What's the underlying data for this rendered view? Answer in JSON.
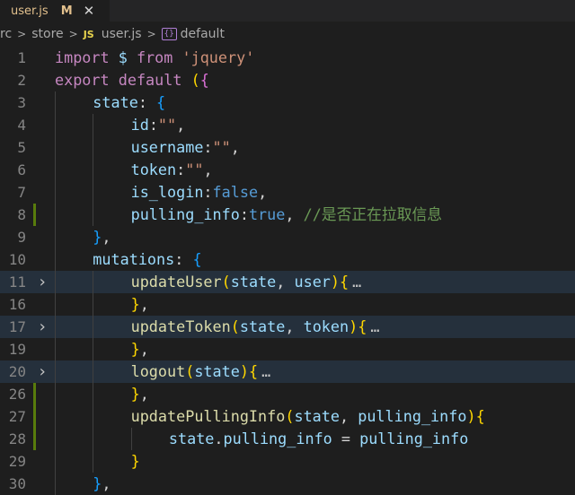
{
  "tab": {
    "label": "user.js",
    "modified": "M",
    "close": "✕"
  },
  "breadcrumb": {
    "segments": [
      "rc",
      "store",
      "user.js",
      "default"
    ],
    "file_badge": "JS"
  },
  "colors": {
    "keyword": "#c586c0",
    "storage": "#569cd6",
    "variable": "#9cdcfe",
    "function": "#dcdcaa",
    "string": "#ce9178",
    "comment": "#6a9955",
    "bracket1": "#ffd700",
    "bracket2": "#da70d6",
    "bracket3": "#179fff",
    "punct": "#d4d4d4",
    "fold": "#c5c5c5",
    "ellipsis": "#c5c5c5"
  },
  "lines": [
    {
      "num": "1",
      "indent": 0,
      "tokens": [
        {
          "t": "import",
          "c": "keyword"
        },
        {
          "t": " "
        },
        {
          "t": "$",
          "c": "variable"
        },
        {
          "t": " "
        },
        {
          "t": "from",
          "c": "keyword"
        },
        {
          "t": " "
        },
        {
          "t": "'jquery'",
          "c": "string"
        }
      ]
    },
    {
      "num": "2",
      "indent": 0,
      "tokens": [
        {
          "t": "export",
          "c": "keyword"
        },
        {
          "t": " "
        },
        {
          "t": "default",
          "c": "keyword"
        },
        {
          "t": " "
        },
        {
          "t": "(",
          "c": "bracket1"
        },
        {
          "t": "{",
          "c": "bracket2"
        }
      ]
    },
    {
      "num": "3",
      "indent": 1,
      "tokens": [
        {
          "t": "state",
          "c": "variable"
        },
        {
          "t": ": "
        },
        {
          "t": "{",
          "c": "bracket3"
        }
      ]
    },
    {
      "num": "4",
      "indent": 2,
      "tokens": [
        {
          "t": "id",
          "c": "variable"
        },
        {
          "t": ":"
        },
        {
          "t": "\"\"",
          "c": "string"
        },
        {
          "t": ","
        }
      ]
    },
    {
      "num": "5",
      "indent": 2,
      "tokens": [
        {
          "t": "username",
          "c": "variable"
        },
        {
          "t": ":"
        },
        {
          "t": "\"\"",
          "c": "string"
        },
        {
          "t": ","
        }
      ]
    },
    {
      "num": "6",
      "indent": 2,
      "tokens": [
        {
          "t": "token",
          "c": "variable"
        },
        {
          "t": ":"
        },
        {
          "t": "\"\"",
          "c": "string"
        },
        {
          "t": ","
        }
      ]
    },
    {
      "num": "7",
      "indent": 2,
      "tokens": [
        {
          "t": "is_login",
          "c": "variable"
        },
        {
          "t": ":"
        },
        {
          "t": "false",
          "c": "storage"
        },
        {
          "t": ","
        }
      ]
    },
    {
      "num": "8",
      "indent": 2,
      "modified": true,
      "tokens": [
        {
          "t": "pulling_info",
          "c": "variable"
        },
        {
          "t": ":"
        },
        {
          "t": "true",
          "c": "storage"
        },
        {
          "t": ", "
        },
        {
          "t": "//是否正在拉取信息",
          "c": "comment"
        }
      ]
    },
    {
      "num": "9",
      "indent": 1,
      "tokens": [
        {
          "t": "}",
          "c": "bracket3"
        },
        {
          "t": ","
        }
      ]
    },
    {
      "num": "10",
      "indent": 1,
      "tokens": [
        {
          "t": "mutations",
          "c": "variable"
        },
        {
          "t": ": "
        },
        {
          "t": "{",
          "c": "bracket3"
        }
      ]
    },
    {
      "num": "11",
      "indent": 2,
      "folded": true,
      "highlight": true,
      "tokens": [
        {
          "t": "updateUser",
          "c": "function"
        },
        {
          "t": "(",
          "c": "bracket1"
        },
        {
          "t": "state",
          "c": "variable"
        },
        {
          "t": ", "
        },
        {
          "t": "user",
          "c": "variable"
        },
        {
          "t": ")",
          "c": "bracket1"
        },
        {
          "t": "{",
          "c": "bracket1"
        },
        {
          "t": "…",
          "c": "ellipsis"
        }
      ]
    },
    {
      "num": "16",
      "indent": 2,
      "tokens": [
        {
          "t": "}",
          "c": "bracket1"
        },
        {
          "t": ","
        }
      ]
    },
    {
      "num": "17",
      "indent": 2,
      "folded": true,
      "highlight": true,
      "tokens": [
        {
          "t": "updateToken",
          "c": "function"
        },
        {
          "t": "(",
          "c": "bracket1"
        },
        {
          "t": "state",
          "c": "variable"
        },
        {
          "t": ", "
        },
        {
          "t": "token",
          "c": "variable"
        },
        {
          "t": ")",
          "c": "bracket1"
        },
        {
          "t": "{",
          "c": "bracket1"
        },
        {
          "t": "…",
          "c": "ellipsis"
        }
      ]
    },
    {
      "num": "19",
      "indent": 2,
      "tokens": [
        {
          "t": "}",
          "c": "bracket1"
        },
        {
          "t": ","
        }
      ]
    },
    {
      "num": "20",
      "indent": 2,
      "folded": true,
      "highlight": true,
      "tokens": [
        {
          "t": "logout",
          "c": "function"
        },
        {
          "t": "(",
          "c": "bracket1"
        },
        {
          "t": "state",
          "c": "variable"
        },
        {
          "t": ")",
          "c": "bracket1"
        },
        {
          "t": "{",
          "c": "bracket1"
        },
        {
          "t": "…",
          "c": "ellipsis"
        }
      ]
    },
    {
      "num": "26",
      "indent": 2,
      "modified": true,
      "tokens": [
        {
          "t": "}",
          "c": "bracket1"
        },
        {
          "t": ","
        }
      ]
    },
    {
      "num": "27",
      "indent": 2,
      "modified": true,
      "tokens": [
        {
          "t": "updatePullingInfo",
          "c": "function"
        },
        {
          "t": "(",
          "c": "bracket1"
        },
        {
          "t": "state",
          "c": "variable"
        },
        {
          "t": ", "
        },
        {
          "t": "pulling_info",
          "c": "variable"
        },
        {
          "t": ")",
          "c": "bracket1"
        },
        {
          "t": "{",
          "c": "bracket1"
        }
      ]
    },
    {
      "num": "28",
      "indent": 3,
      "modified": true,
      "tokens": [
        {
          "t": "state",
          "c": "variable"
        },
        {
          "t": "."
        },
        {
          "t": "pulling_info",
          "c": "variable"
        },
        {
          "t": " = "
        },
        {
          "t": "pulling_info",
          "c": "variable"
        }
      ]
    },
    {
      "num": "29",
      "indent": 2,
      "tokens": [
        {
          "t": "}",
          "c": "bracket1"
        }
      ]
    },
    {
      "num": "30",
      "indent": 1,
      "tokens": [
        {
          "t": "}",
          "c": "bracket3"
        },
        {
          "t": ","
        }
      ]
    }
  ]
}
